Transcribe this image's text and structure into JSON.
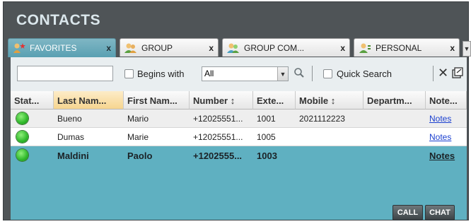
{
  "title": "CONTACTS",
  "tabs": [
    {
      "label": "FAVORITES",
      "close": "x",
      "icon": "favorites-star-icon"
    },
    {
      "label": "GROUP",
      "close": "x",
      "icon": "group-icon"
    },
    {
      "label": "GROUP COM...",
      "close": "x",
      "icon": "group-common-icon"
    },
    {
      "label": "PERSONAL",
      "close": "x",
      "icon": "personal-contact-icon"
    }
  ],
  "toolbar": {
    "search_value": "",
    "begins_with_label": "Begins with",
    "begins_with_checked": false,
    "filter_selected": "All",
    "quick_search_label": "Quick Search",
    "quick_search_checked": false,
    "clear_symbol": "✕"
  },
  "table": {
    "columns": [
      "Stat...",
      "Last Nam...",
      "First Nam...",
      "Number ↕",
      "Exte...",
      "Mobile ↕",
      "Departm...",
      "Note..."
    ],
    "rows": [
      {
        "status": "available",
        "last": "Bueno",
        "first": "Mario",
        "number": "+12025551...",
        "ext": "1001",
        "mobile": "2021112223",
        "dept": "",
        "notes": "Notes"
      },
      {
        "status": "available",
        "last": "Dumas",
        "first": "Marie",
        "number": "+12025551...",
        "ext": "1005",
        "mobile": "",
        "dept": "",
        "notes": "Notes"
      },
      {
        "status": "available",
        "last": "Maldini",
        "first": "Paolo",
        "number": "+1202555...",
        "ext": "1003",
        "mobile": "",
        "dept": "",
        "notes": "Notes"
      }
    ],
    "selected_row": 2
  },
  "buttons": {
    "call": "CALL",
    "chat": "CHAT"
  },
  "colors": {
    "header_bg": "#4f5457",
    "selected": "#5fb0c1",
    "status_available": "#2fb82a",
    "link": "#1a3fd0"
  }
}
